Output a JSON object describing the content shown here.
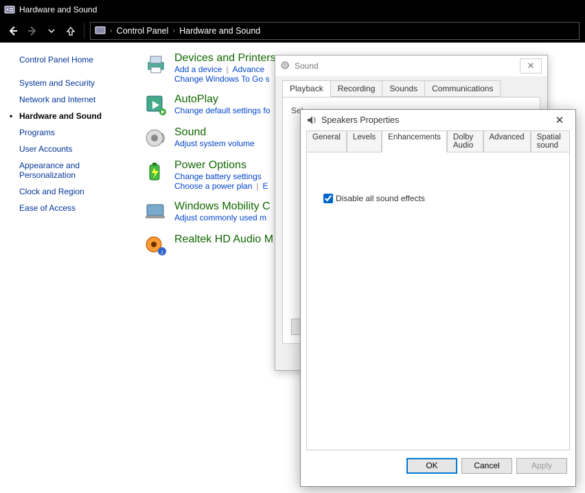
{
  "window": {
    "title": "Hardware and Sound"
  },
  "breadcrumb": {
    "item0": "Control Panel",
    "item1": "Hardware and Sound"
  },
  "sidebar": {
    "home": "Control Panel Home",
    "items": [
      "System and Security",
      "Network and Internet",
      "Hardware and Sound",
      "Programs",
      "User Accounts",
      "Appearance and Personalization",
      "Clock and Region",
      "Ease of Access"
    ]
  },
  "categories": [
    {
      "title": "Devices and Printers",
      "links": [
        "Add a device",
        "Advance",
        "Change Windows To Go s"
      ]
    },
    {
      "title": "AutoPlay",
      "links": [
        "Change default settings fo"
      ]
    },
    {
      "title": "Sound",
      "links": [
        "Adjust system volume"
      ]
    },
    {
      "title": "Power Options",
      "links": [
        "Change battery settings",
        "Choose a power plan",
        "E"
      ]
    },
    {
      "title": "Windows Mobility C",
      "links": [
        "Adjust commonly used m"
      ]
    },
    {
      "title": "Realtek HD Audio M",
      "links": []
    }
  ],
  "soundDialog": {
    "title": "Sound",
    "tabs": [
      "Playback",
      "Recording",
      "Sounds",
      "Communications"
    ],
    "active": "Playback",
    "bodyHint": "Sel"
  },
  "speakersDialog": {
    "title": "Speakers Properties",
    "tabs": [
      "General",
      "Levels",
      "Enhancements",
      "Dolby Audio",
      "Advanced",
      "Spatial sound"
    ],
    "active": "Enhancements",
    "checkboxLabel": "Disable all sound effects",
    "checkboxChecked": true,
    "buttons": {
      "ok": "OK",
      "cancel": "Cancel",
      "apply": "Apply"
    }
  }
}
